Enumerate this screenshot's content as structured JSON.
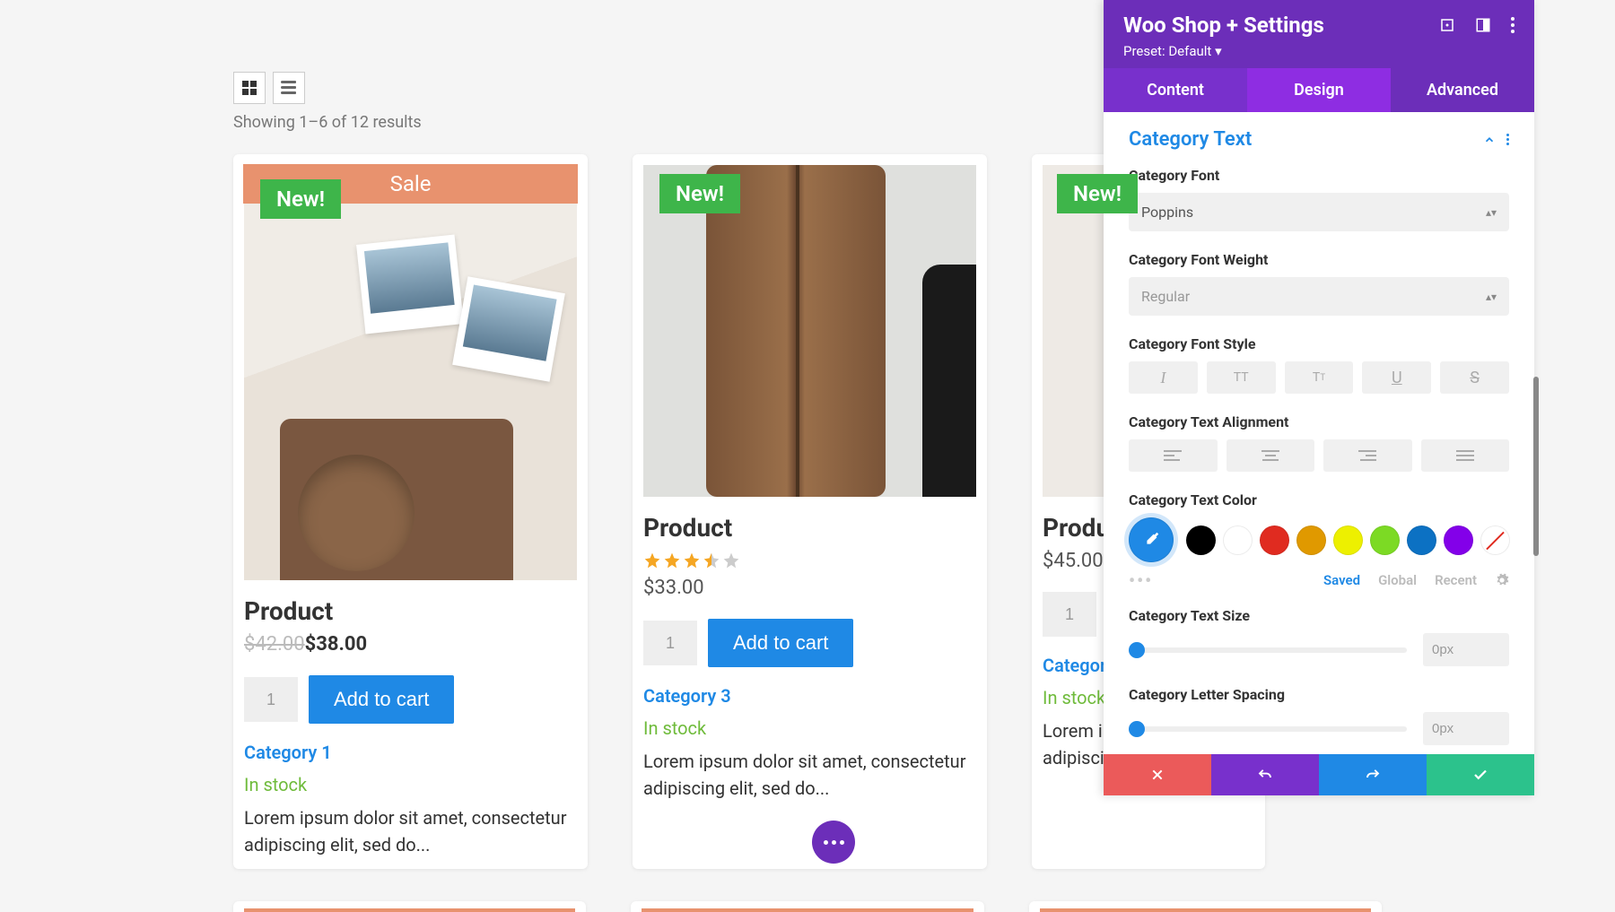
{
  "shop": {
    "results_text": "Showing 1–6 of 12 results",
    "sale_label": "Sale",
    "new_label": "New!",
    "add_to_cart": "Add to cart",
    "products": [
      {
        "title": "Product",
        "old_price": "$42.00",
        "price": "$38.00",
        "qty": "1",
        "category": "Category 1",
        "stock": "In stock",
        "desc": "Lorem ipsum dolor sit amet, consectetur adipiscing elit, sed do..."
      },
      {
        "title": "Product",
        "price": "$33.00",
        "qty": "1",
        "category": "Category 3",
        "stock": "In stock",
        "desc": "Lorem ipsum dolor sit amet, consectetur adipiscing elit, sed do...",
        "rating": 3.5
      },
      {
        "title": "Product",
        "price": "$45.00",
        "qty": "1",
        "stock": "In stock",
        "desc_partial": "Lorem ip\nadipiscin"
      }
    ]
  },
  "panel": {
    "title": "Woo Shop + Settings",
    "preset": "Preset: Default",
    "tabs": {
      "content": "Content",
      "design": "Design",
      "advanced": "Advanced"
    },
    "section_title": "Category Text",
    "labels": {
      "font": "Category Font",
      "weight": "Category Font Weight",
      "style": "Category Font Style",
      "align": "Category Text Alignment",
      "color": "Category Text Color",
      "size": "Category Text Size",
      "spacing": "Category Letter Spacing"
    },
    "font_value": "Poppins",
    "weight_value": "Regular",
    "colors": [
      "#1f89e5",
      "#000000",
      "#ffffff",
      "#e02b20",
      "#e09900",
      "#edf000",
      "#7cda24",
      "#0c71c3",
      "#8300e9"
    ],
    "color_tabs": {
      "saved": "Saved",
      "global": "Global",
      "recent": "Recent"
    },
    "size_value": "0px",
    "spacing_value": "0px"
  },
  "actions": {
    "close": "close",
    "undo": "undo",
    "redo": "redo",
    "confirm": "confirm"
  }
}
